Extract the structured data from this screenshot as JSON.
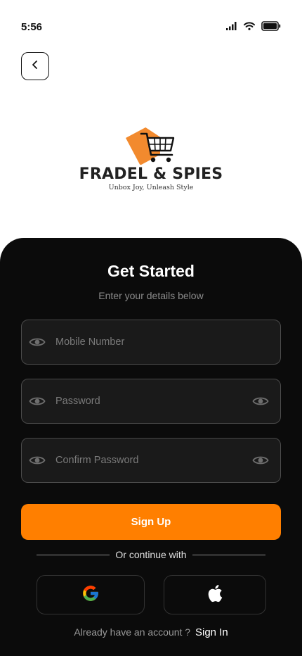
{
  "status_bar": {
    "time": "5:56",
    "icons": [
      "signal-icon",
      "wifi-icon",
      "battery-icon"
    ]
  },
  "header": {
    "back_icon": "chevron-left-icon"
  },
  "brand": {
    "name": "FRADEL & SPIES",
    "tagline": "Unbox Joy, Unleash Style",
    "accent_color": "#F28A2E"
  },
  "form": {
    "title": "Get Started",
    "subtitle": "Enter your details below",
    "fields": [
      {
        "placeholder": "Mobile Number",
        "value": "",
        "lead_icon": "eye-icon"
      },
      {
        "placeholder": "Password",
        "value": "",
        "lead_icon": "eye-icon",
        "trail_icon": "eye-toggle-icon"
      },
      {
        "placeholder": "Confirm Password",
        "value": "",
        "lead_icon": "eye-icon",
        "trail_icon": "eye-toggle-icon"
      }
    ],
    "submit_label": "Sign Up",
    "submit_color": "#FF7F00",
    "divider_text": "Or continue with",
    "social": [
      {
        "name": "google",
        "icon": "google-icon"
      },
      {
        "name": "apple",
        "icon": "apple-icon"
      }
    ],
    "footer_prompt": "Already have an account ?",
    "footer_link": "Sign In"
  },
  "colors": {
    "panel_bg": "#0B0B0B",
    "field_bg": "#1A1A1A"
  }
}
